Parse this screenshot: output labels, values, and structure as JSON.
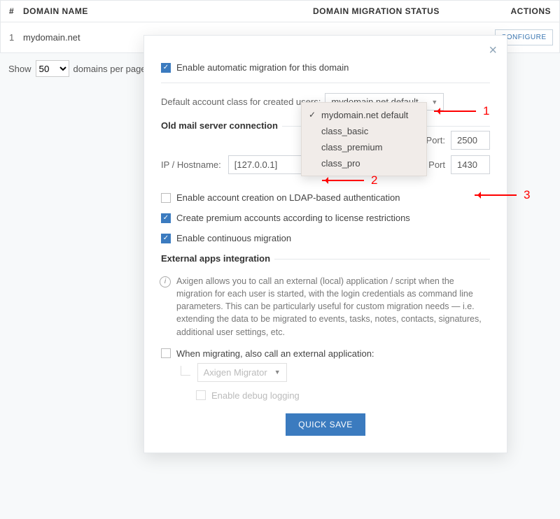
{
  "table": {
    "headers": {
      "num": "#",
      "name": "DOMAIN NAME",
      "status": "DOMAIN MIGRATION STATUS",
      "actions": "ACTIONS"
    },
    "row": {
      "num": "1",
      "name": "mydomain.net"
    },
    "configure_label": "CONFIGURE",
    "pager": {
      "show": "Show",
      "value": "50",
      "suffix": "domains per page"
    }
  },
  "modal": {
    "enable_auto": "Enable automatic migration for this domain",
    "default_class_label": "Default account class for created users:",
    "default_class_value": "mydomain.net default",
    "dropdown_options": [
      "mydomain.net default",
      "class_basic",
      "class_premium",
      "class_pro"
    ],
    "old_mail_legend": "Old mail server connection",
    "ip_label": "IP / Hostname:",
    "ip_value": "[127.0.0.1]",
    "smtp_label": "SMTP Port:",
    "smtp_value": "2500",
    "imap_label": "IMAP Port",
    "imap_value": "1430",
    "opt_ldap": "Enable account creation on LDAP-based authentication",
    "opt_premium": "Create premium accounts according to license restrictions",
    "opt_continuous": "Enable continuous migration",
    "ext_legend": "External apps integration",
    "ext_note": "Axigen allows you to call an external (local) application / script when the migration for each user is started, with the login credentials as command line parameters. This can be particularly useful for custom migration needs — i.e. extending the data to be migrated to events, tasks, notes, contacts, signatures, additional user settings, etc.",
    "ext_call_label": "When migrating, also call an external application:",
    "ext_app_value": "Axigen Migrator",
    "ext_debug": "Enable debug logging",
    "quick_save": "QUICK SAVE"
  },
  "annotations": {
    "a1": "1",
    "a2": "2",
    "a3": "3"
  }
}
